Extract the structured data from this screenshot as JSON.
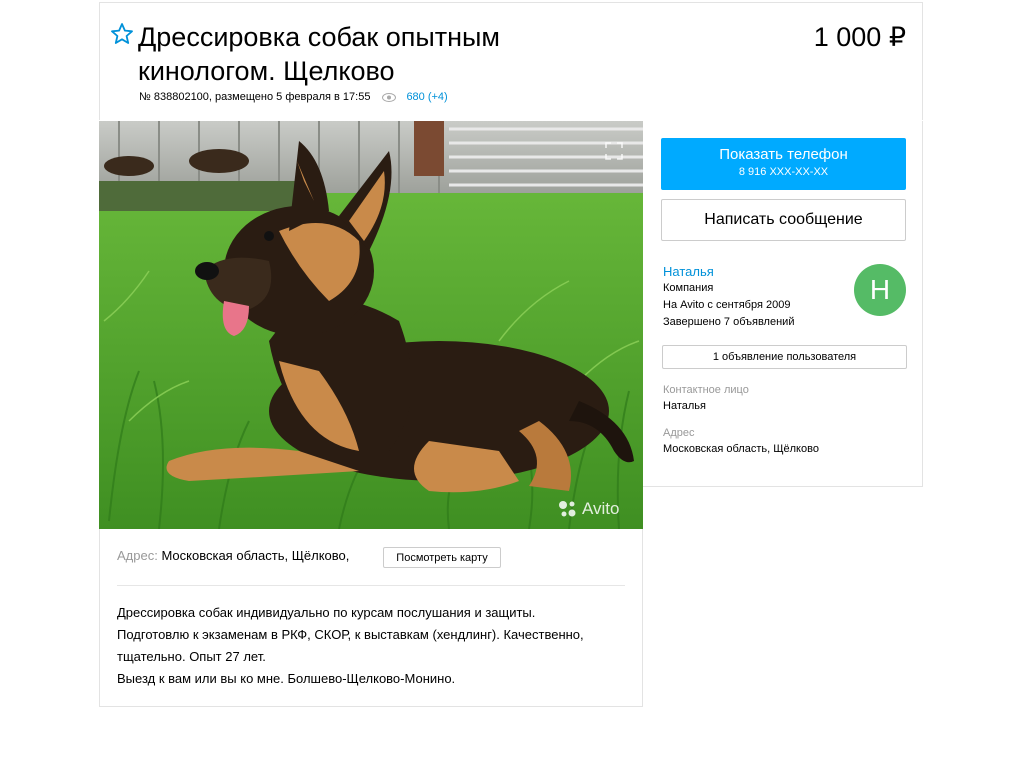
{
  "listing": {
    "title": "Дрессировка собак опытным кинологом. Щелково",
    "price": "1 000 ₽",
    "meta_text": "№ 838802100, размещено 5 февраля в 17:55",
    "views": "680 (+4)"
  },
  "photo": {
    "watermark": "Avito"
  },
  "address": {
    "label": "Адрес:",
    "value": "Московская область, Щёлково,",
    "map_button": "Посмотреть карту"
  },
  "description": [
    "Дрессировка собак индивидуально по курсам послушания и защиты.",
    "Подготовлю к экзаменам в РКФ, СКОР, к выставкам (хендлинг). Качественно,",
    "тщательно. Опыт 27 лет.",
    "Выезд к вам или вы ко мне. Болшево-Щелково-Монино."
  ],
  "contact": {
    "phone_label": "Показать телефон",
    "phone_masked": "8 916 XXX-XX-XX",
    "message_label": "Написать сообщение"
  },
  "seller": {
    "name": "Наталья",
    "type": "Компания",
    "since": "На Avito с сентября 2009",
    "completed": "Завершено 7 объявлений",
    "avatar_letter": "Н",
    "ads_button": "1 объявление пользователя",
    "contact_label": "Контактное лицо",
    "contact_value": "Наталья",
    "address_label": "Адрес",
    "address_value": "Московская область, Щёлково"
  },
  "colors": {
    "accent": "#00aaff",
    "link": "#0091d9",
    "avatar": "#55bb66"
  }
}
